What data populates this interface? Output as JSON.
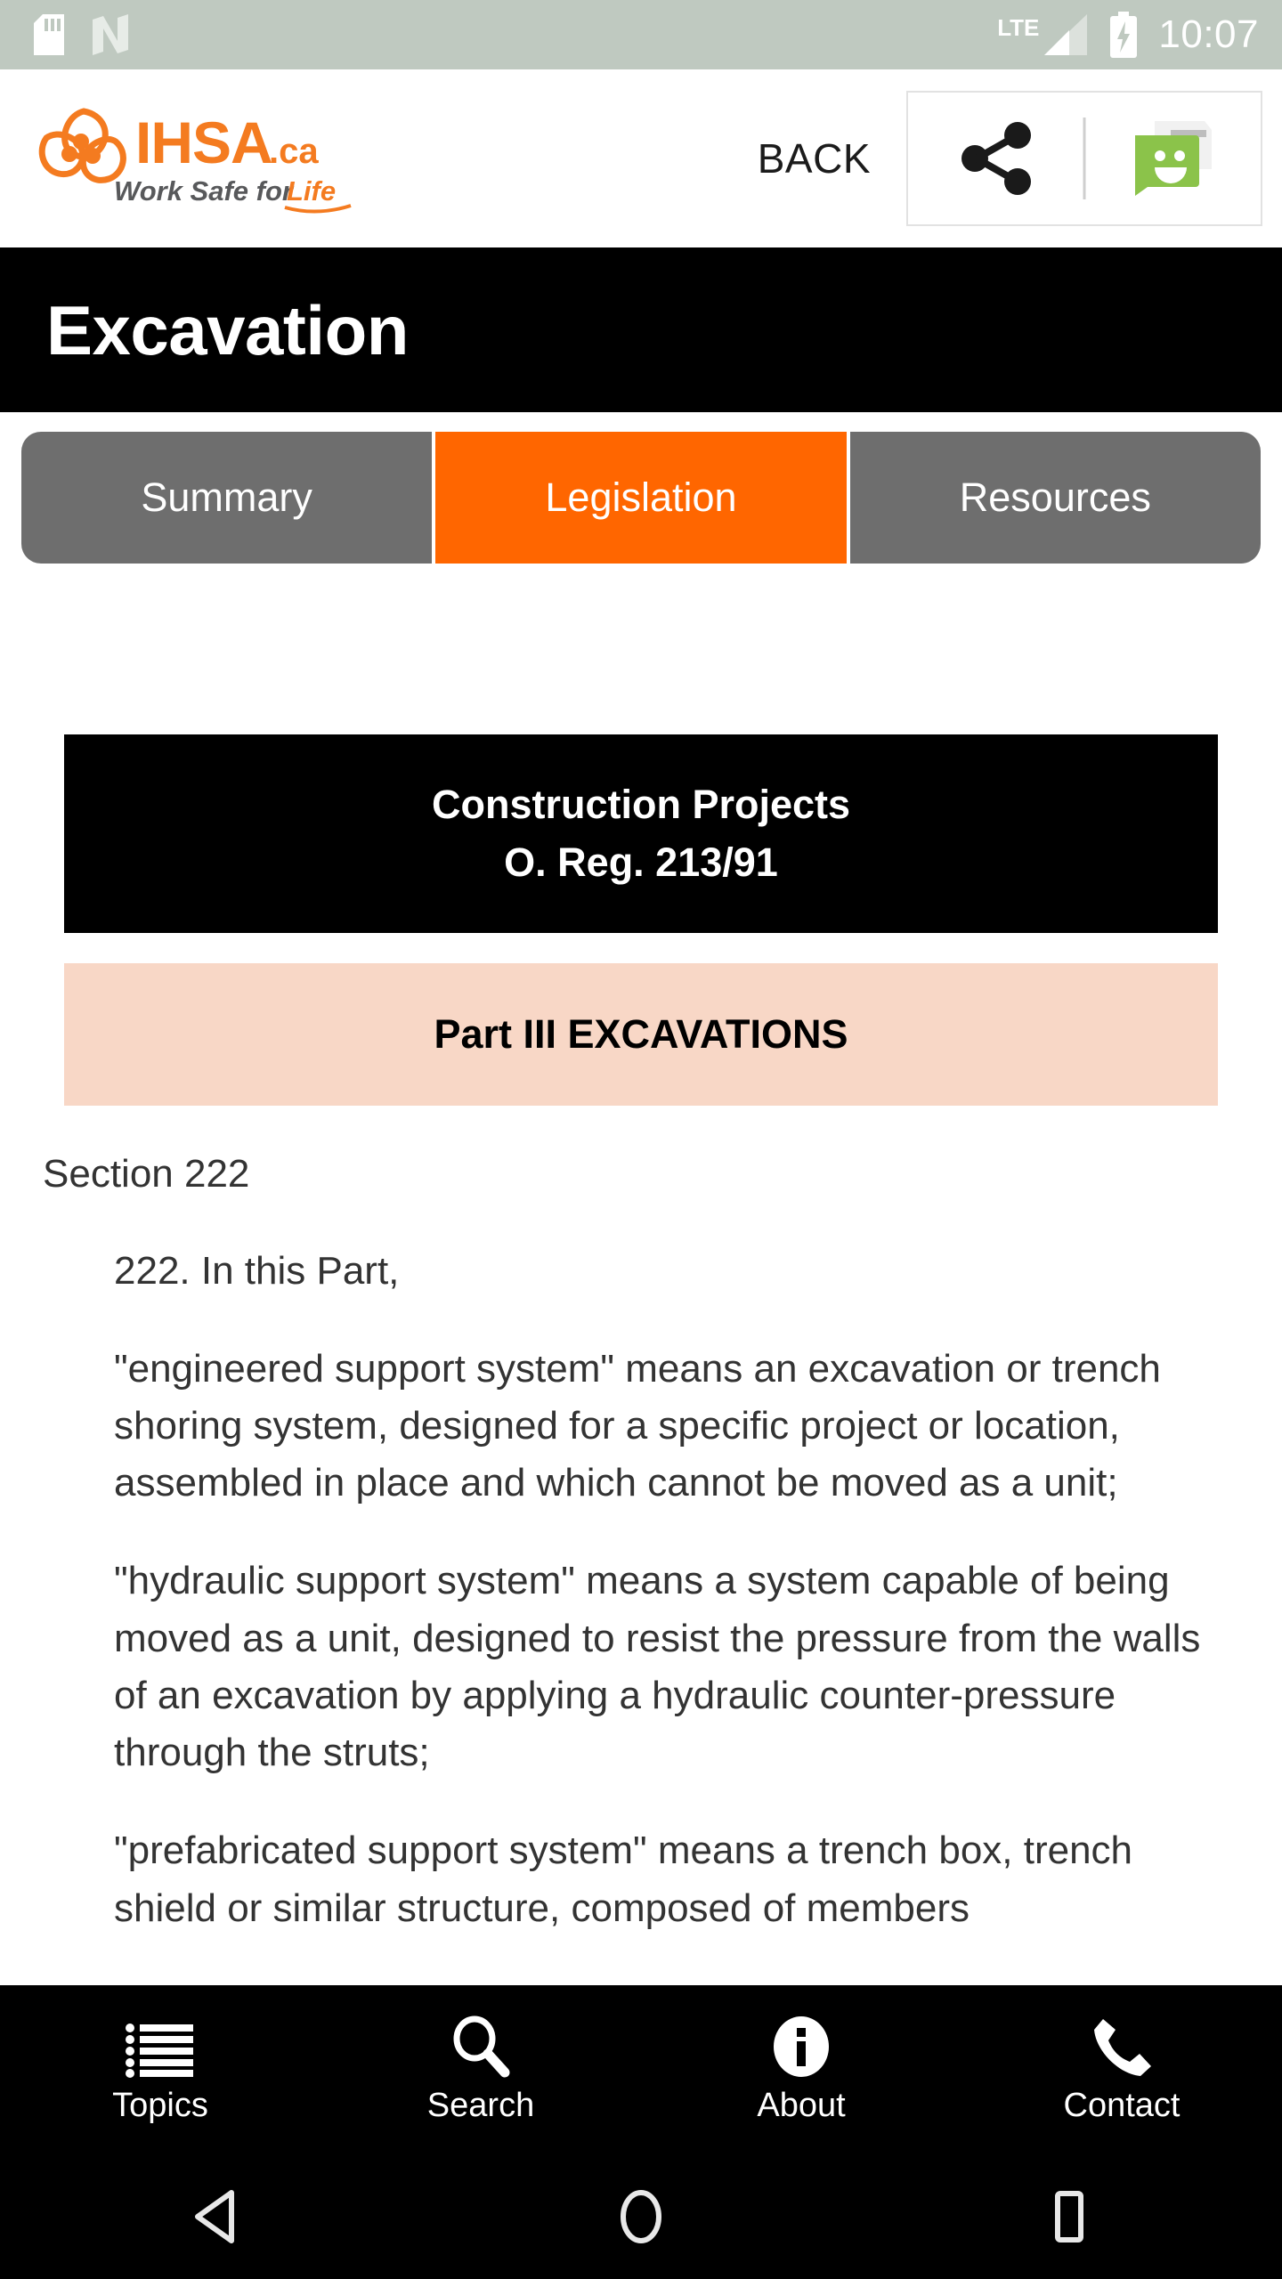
{
  "status_bar": {
    "sd_card_icon": "sd-card-icon",
    "nfc_icon": "nfc-n-icon",
    "network_label": "LTE",
    "signal_icon": "signal-bars-icon",
    "battery_icon": "battery-charging-icon",
    "time": "10:07",
    "background_color": "#bfc9c0"
  },
  "header": {
    "logo": {
      "brand": "IHSA",
      "domain": ".ca",
      "tagline_plain": "Work Safe for ",
      "tagline_accent": "Life",
      "mark_icon": "trillium-logo-icon",
      "accent_color": "#f47b20",
      "tagline_color": "#58595b"
    },
    "back_label": "BACK",
    "share_icon": "share-icon",
    "messenger_icon": "messenger-app-icon",
    "messenger_color": "#8bc34a"
  },
  "page_title": "Excavation",
  "tabs": [
    {
      "label": "Summary",
      "active": false
    },
    {
      "label": "Legislation",
      "active": true
    },
    {
      "label": "Resources",
      "active": false
    }
  ],
  "tab_colors": {
    "inactive": "#6e6e6e",
    "active": "#ff6600"
  },
  "content": {
    "regulation_box": {
      "line1": "Construction Projects",
      "line2": "O. Reg. 213/91",
      "background_color": "#000000"
    },
    "part_banner": {
      "text": "Part III EXCAVATIONS",
      "background_color": "#f8d7c6"
    },
    "section_label": "Section 222",
    "paragraphs": [
      "222. In this Part,",
      "\"engineered support system\" means an excavation or trench shoring system, designed for a specific project or location, assembled in place and which cannot be moved as a unit;",
      "\"hydraulic support system\" means a system capable of being moved as a unit, designed to resist the pressure from the walls of an excavation by applying a hydraulic counter-pressure through the struts;",
      "\"prefabricated support system\" means a trench box, trench shield or similar structure, composed of members"
    ]
  },
  "bottom_nav": [
    {
      "label": "Topics",
      "icon": "bulleted-list-icon"
    },
    {
      "label": "Search",
      "icon": "magnifier-icon"
    },
    {
      "label": "About",
      "icon": "info-circle-icon"
    },
    {
      "label": "Contact",
      "icon": "phone-icon"
    }
  ],
  "system_nav": [
    {
      "name": "back",
      "icon": "triangle-back-icon"
    },
    {
      "name": "home",
      "icon": "circle-home-icon"
    },
    {
      "name": "recents",
      "icon": "square-recents-icon"
    }
  ]
}
